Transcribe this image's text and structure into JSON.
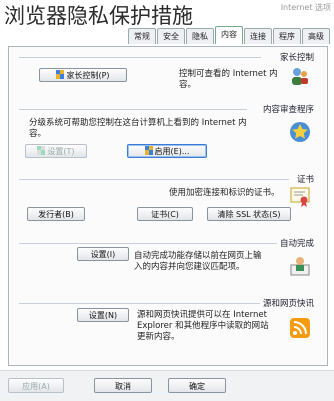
{
  "caption": "浏览器隐私保护措施",
  "window_title": "Internet 选项",
  "tabs": [
    {
      "label": "常规",
      "active": false
    },
    {
      "label": "安全",
      "active": false
    },
    {
      "label": "隐私",
      "active": false
    },
    {
      "label": "内容",
      "active": true
    },
    {
      "label": "连接",
      "active": false
    },
    {
      "label": "程序",
      "active": false
    },
    {
      "label": "高级",
      "active": false
    }
  ],
  "parental": {
    "title": "家长控制",
    "desc": "控制可查看的 Internet 内容。",
    "button": "家长控制(P)"
  },
  "advisor": {
    "title": "内容审查程序",
    "desc_line1": "分级系统可帮助您控制在这台计算机上看到的 Internet 内",
    "desc_line2": "容。",
    "enable_button": "启用(E)...",
    "settings_button": "设置(T)"
  },
  "certificates": {
    "title": "证书",
    "desc": "使用加密连接和标识的证书。",
    "clear_ssl_button": "清除 SSL 状态(S)",
    "certs_button": "证书(C)",
    "publishers_button": "发行者(B)"
  },
  "autocomplete": {
    "title": "自动完成",
    "desc_line1": "自动完成功能存储以前在网页上输",
    "desc_line2": "入的内容并向您建议匹配项。",
    "settings_button": "设置(I)"
  },
  "feeds": {
    "title": "源和网页快讯",
    "desc_line1": "源和网页快讯提供可以在 Internet",
    "desc_line2": "Explorer 和其他程序中读取的网站",
    "desc_line3": "更新内容。",
    "settings_button": "设置(N)"
  },
  "footer": {
    "ok": "确定",
    "cancel": "取消",
    "apply": "应用(A)"
  }
}
